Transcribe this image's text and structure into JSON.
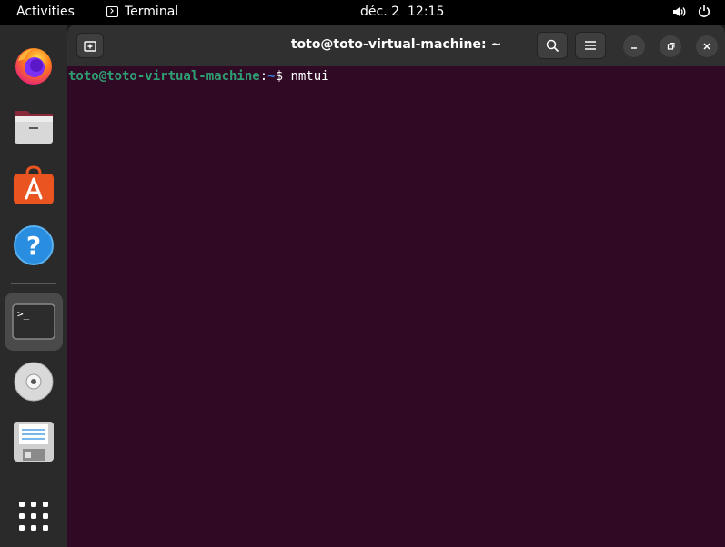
{
  "topbar": {
    "activities": "Activities",
    "app_name": "Terminal",
    "date": "déc. 2",
    "time": "12:15"
  },
  "dock": {
    "items": [
      {
        "name": "firefox-icon"
      },
      {
        "name": "files-icon"
      },
      {
        "name": "software-center-icon"
      },
      {
        "name": "help-icon"
      },
      {
        "name": "terminal-icon",
        "terminal_glyph": ">_"
      },
      {
        "name": "dvd-icon"
      },
      {
        "name": "floppy-disk-icon"
      },
      {
        "name": "show-apps-icon"
      }
    ]
  },
  "window": {
    "title": "toto@toto-virtual-machine: ~"
  },
  "terminal": {
    "user_host": "toto@toto-virtual-machine",
    "colon": ":",
    "path": "~",
    "prompt_symbol": "$ ",
    "command": "nmtui"
  },
  "colors": {
    "terminal_bg": "#300a24",
    "prompt_user": "#2e9e73",
    "prompt_path": "#3c7fd9",
    "accent": "#e95420"
  }
}
